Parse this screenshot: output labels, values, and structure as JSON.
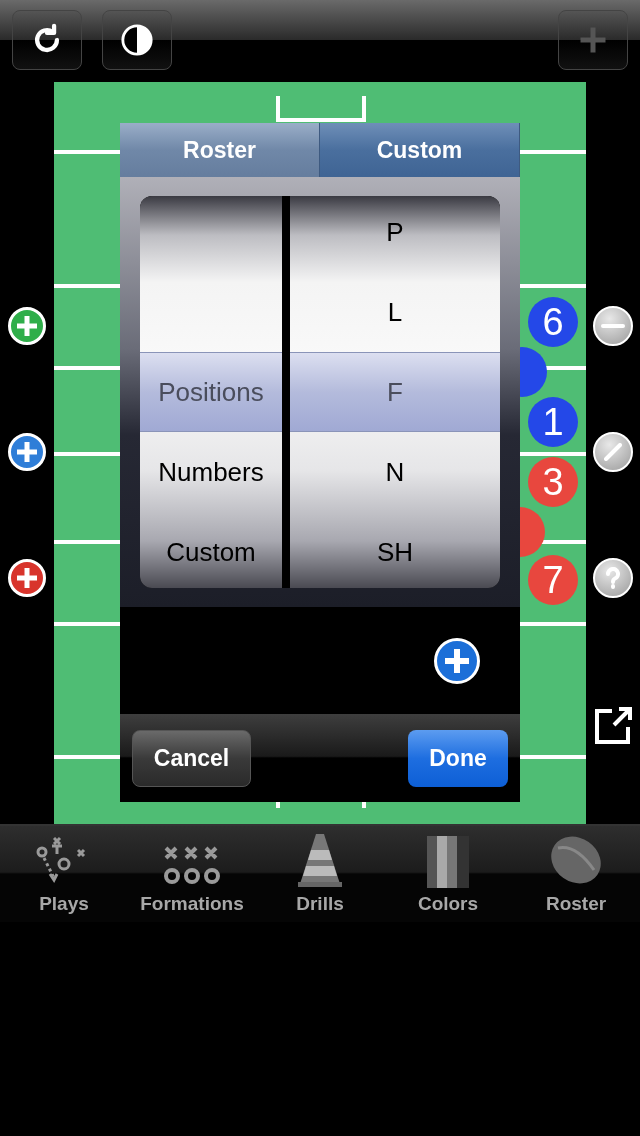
{
  "top_toolbar": [
    {
      "kind": "refresh",
      "disabled": false
    },
    {
      "kind": "contrast",
      "disabled": false
    },
    {
      "kind": "add",
      "disabled": true
    }
  ],
  "left_tools": [
    {
      "kind": "add",
      "color": "#2fae4a"
    },
    {
      "kind": "add",
      "color": "#2f7ed8"
    },
    {
      "kind": "add",
      "color": "#d8342c"
    }
  ],
  "right_tools": [
    {
      "kind": "remove"
    },
    {
      "kind": "edit"
    },
    {
      "kind": "help"
    },
    {
      "kind": "share"
    }
  ],
  "players": [
    {
      "number": "6",
      "color": "#2448e8"
    },
    {
      "color": "#2448e8"
    },
    {
      "number": "1",
      "color": "#2448e8"
    },
    {
      "number": "3",
      "color": "#e8473e"
    },
    {
      "color": "#e8473e"
    },
    {
      "number": "7",
      "color": "#e8473e"
    }
  ],
  "picker": {
    "segments": [
      {
        "label": "Roster",
        "selected": false
      },
      {
        "label": "Custom",
        "selected": true
      }
    ],
    "columns": [
      {
        "rows": [
          {
            "label": "Positions",
            "selected": true
          },
          {
            "label": "Numbers",
            "selected": false
          },
          {
            "label": "Custom",
            "selected": false
          }
        ]
      },
      {
        "rows": [
          {
            "label": "P",
            "selected": false
          },
          {
            "label": "L",
            "selected": false
          },
          {
            "label": "F",
            "selected": true
          },
          {
            "label": "N",
            "selected": false
          },
          {
            "label": "SH",
            "selected": false
          }
        ]
      }
    ],
    "buttons": [
      {
        "label": "Cancel",
        "kind": "cancel"
      },
      {
        "label": "Done",
        "kind": "done"
      }
    ]
  },
  "tab_bar": [
    {
      "label": "Plays",
      "kind": "plays"
    },
    {
      "label": "Formations",
      "kind": "formations"
    },
    {
      "label": "Drills",
      "kind": "drills"
    },
    {
      "label": "Colors",
      "kind": "colors"
    },
    {
      "label": "Roster",
      "kind": "roster"
    }
  ]
}
